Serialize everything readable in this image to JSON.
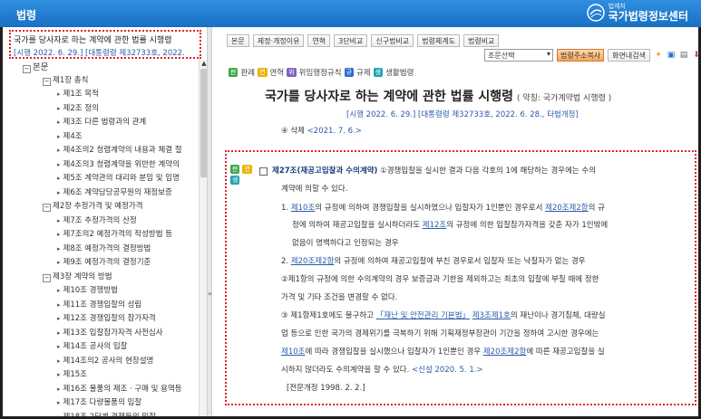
{
  "app": {
    "title": "법령",
    "brand_sub": "법제처",
    "brand_name": "국가법령정보센터"
  },
  "left": {
    "law_name": "국가를 당사자로 하는 계약에 관한 법률 시행령",
    "law_meta": "[시행 2022. 6. 29.] [대통령령 제32733호, 2022.",
    "tree": [
      {
        "level": 0,
        "toggle": "−",
        "label": "본문"
      },
      {
        "level": 1,
        "toggle": "−",
        "label": "제1장 총칙"
      },
      {
        "level": 2,
        "label": "제1조 목적"
      },
      {
        "level": 2,
        "label": "제2조 정의"
      },
      {
        "level": 2,
        "label": "제3조 다른 법령과의 관계"
      },
      {
        "level": 2,
        "label": "제4조"
      },
      {
        "level": 2,
        "label": "제4조의2 청렴계약의 내용과 체결 절"
      },
      {
        "level": 2,
        "label": "제4조의3 청렴계약을 위반한 계약의"
      },
      {
        "level": 2,
        "label": "제5조 계약관의 대리와 분임 및 임명"
      },
      {
        "level": 2,
        "label": "제6조 계약담당공무원의 재정보증"
      },
      {
        "level": 1,
        "toggle": "−",
        "label": "제2장 추정가격 및 예정가격"
      },
      {
        "level": 2,
        "label": "제7조 추정가격의 산정"
      },
      {
        "level": 2,
        "label": "제7조의2 예정가격의 작성방법 등"
      },
      {
        "level": 2,
        "label": "제8조 예정가격의 결정방법"
      },
      {
        "level": 2,
        "label": "제9조 예정가격의 결정기준"
      },
      {
        "level": 1,
        "toggle": "−",
        "label": "제3장 계약의 방법"
      },
      {
        "level": 2,
        "label": "제10조 경쟁방법"
      },
      {
        "level": 2,
        "label": "제11조 경쟁입찰의 성립"
      },
      {
        "level": 2,
        "label": "제12조 경쟁입찰의 참가자격"
      },
      {
        "level": 2,
        "label": "제13조 입찰참가자격 사전심사"
      },
      {
        "level": 2,
        "label": "제14조 공사의 입찰"
      },
      {
        "level": 2,
        "label": "제14조의2 공사의 현장설명"
      },
      {
        "level": 2,
        "label": "제15조"
      },
      {
        "level": 2,
        "label": "제16조 물품의 제조ㆍ구매 및 용역등"
      },
      {
        "level": 2,
        "label": "제17조 다량물품의 입찰"
      },
      {
        "level": 2,
        "label": "제18조 2단계 경쟁등의 입찰"
      }
    ],
    "collapse_icon": "«"
  },
  "toolbar": {
    "row1": [
      "본문",
      "제정·개정이유",
      "연혁",
      "3단비교",
      "신구법비교",
      "법령체계도",
      "법령비교"
    ],
    "select_value": "조문선택",
    "addr_copy": "법령주소복사",
    "screen_search": "화면내검색"
  },
  "legend": {
    "tag_pan": "판",
    "pan_label": "판례",
    "tag_yeon": "연",
    "yeon_label": "연혁",
    "tag_wi": "위",
    "wi_label": "위임행정규칙",
    "tag_gyu": "규",
    "gyu_label": "규제",
    "tag_saeng": "생",
    "saeng_label": "생활법령"
  },
  "doc": {
    "title": "국가를 당사자로 하는 계약에 관한 법률 시행령",
    "abbr": "( 약칭: 국가계약법 시행령 )",
    "promul": "[시행 2022. 6. 29.] [대통령령 제32733호, 2022. 6. 28., 타법개정]",
    "deleted": "④ 삭제",
    "deleted_date": "<2021. 7. 6.>"
  },
  "article": {
    "tags": [
      "판",
      "연",
      "생"
    ],
    "heading": "제27조(재공고입찰과 수의계약)",
    "line1": "①경쟁입찰을 실시한 결과 다음 각호의 1에 해당하는 경우에는 수의",
    "line2": "계약에 의할 수 있다.",
    "i1_a": "1. ",
    "i1_link1": "제10조",
    "i1_b": "의 규정에 의하여 경쟁입찰을 실시하였으나 입찰자가 1인뿐인 경우로서 ",
    "i1_link2": "제20조제2항",
    "i1_c": "의 규",
    "i1_line2_a": "정에 의하여 재공고입찰을 실시하더라도 ",
    "i1_link3": "제12조",
    "i1_line2_b": "의 규정에 의한 입찰참가자격을 갖춘 자가 1인밖에",
    "i1_line3": "없음이 명백하다고 인정되는 경우",
    "i2_a": "2. ",
    "i2_link": "제20조제2항",
    "i2_b": "의 규정에 의하여 재공고입찰에 부친 경우로서 입찰자 또는 낙찰자가 없는 경우",
    "p2_line1": "②제1항의 규정에 의한 수의계약의 경우 보증금과 기한을 제외하고는 최초의 입찰에 부칠 때에 정한",
    "p2_line2": "가격 및 기타 조건을 변경할 수 없다.",
    "p3_a": "③ 제1항제1호에도 불구하고 ",
    "p3_link1": "「재난 및 안전관리 기본법」",
    "p3_b": " ",
    "p3_link2": "제3조제1호",
    "p3_c": "의 재난이나 경기침체, 대량실",
    "p3_line2": "업 등으로 인한 국가의 경제위기를 극복하기 위해 기획재정부장관이 기간을 정하여 고시한 경우에는",
    "p3_line3_link1": "제10조",
    "p3_line3_a": "에 따라 경쟁입찰을 실시했으나 입찰자가 1인뿐인 경우 ",
    "p3_line3_link2": "제20조제2항",
    "p3_line3_b": "에 따른 재공고입찰을 실",
    "p3_line4": "시하지 않더라도 수의계약을 할 수 있다. ",
    "p3_line4_date": "<신설 2020. 5. 1.>",
    "footer": "[전문개정 1998. 2. 2.]"
  }
}
